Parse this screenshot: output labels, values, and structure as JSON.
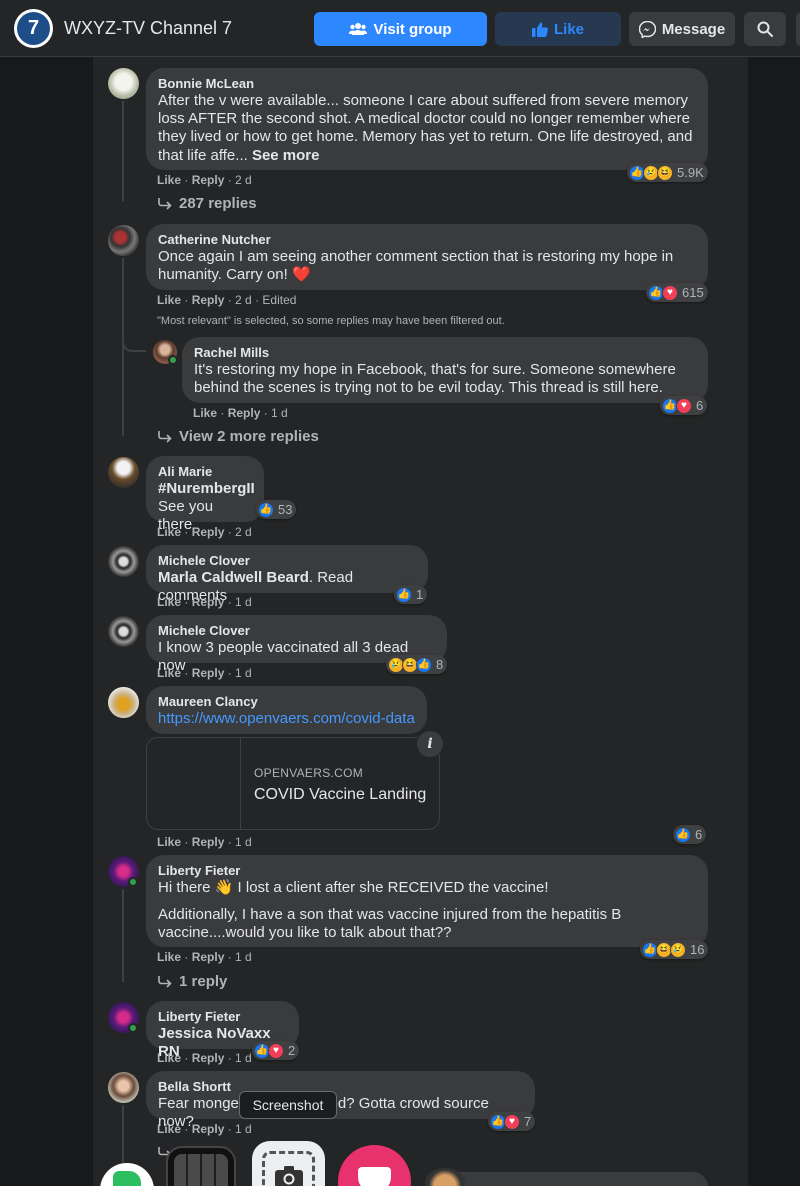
{
  "header": {
    "logo_text": "7",
    "page_name": "WXYZ-TV Channel 7",
    "visit_group_label": "Visit group",
    "like_label": "Like",
    "message_label": "Message"
  },
  "comments": [
    {
      "author": "Bonnie McLean",
      "text": "After the v were available... someone I care about suffered from severe memory loss AFTER the second shot. A medical doctor could no longer remember where they lived or how to get home. Memory has yet to return. One life destroyed, and that life affe...",
      "see_more": "See more",
      "like": "Like",
      "reply": "Reply",
      "time": "2 d",
      "reactions": [
        "like",
        "sad",
        "haha"
      ],
      "reaction_count": "5.9K",
      "replies_label": "287 replies"
    },
    {
      "author": "Catherine Nutcher",
      "text": "Once again I am seeing another comment section that is restoring my hope in humanity. Carry on! ❤️",
      "like": "Like",
      "reply": "Reply",
      "time": "2 d",
      "edited": "Edited",
      "reactions": [
        "like",
        "love"
      ],
      "reaction_count": "615",
      "filter_note": "\"Most relevant\" is selected, so some replies may have been filtered out.",
      "reply_item": {
        "author": "Rachel Mills",
        "text": "It's restoring my hope in Facebook, that's for sure. Someone somewhere behind the scenes is trying not to be evil today. This thread is still here.",
        "like": "Like",
        "reply": "Reply",
        "time": "1 d",
        "reactions": [
          "like",
          "love"
        ],
        "reaction_count": "6"
      },
      "replies_label": "View 2 more replies"
    },
    {
      "author": "Ali Marie",
      "text_line1": "#NurembergII",
      "text_line2": "See you there.",
      "like": "Like",
      "reply": "Reply",
      "time": "2 d",
      "reactions": [
        "like"
      ],
      "reaction_count": "53"
    },
    {
      "author": "Michele Clover",
      "mention": "Marla Caldwell Beard",
      "text": ". Read comments",
      "like": "Like",
      "reply": "Reply",
      "time": "1 d",
      "reactions": [
        "like"
      ],
      "reaction_count": "1"
    },
    {
      "author": "Michele Clover",
      "text": "I know 3 people vaccinated all 3 dead now",
      "like": "Like",
      "reply": "Reply",
      "time": "1 d",
      "reactions": [
        "sad",
        "haha",
        "like"
      ],
      "reaction_count": "8"
    },
    {
      "author": "Maureen Clancy",
      "link": "https://www.openvaers.com/covid-data",
      "preview_domain": "OPENVAERS.COM",
      "preview_title": "COVID Vaccine Landing",
      "like": "Like",
      "reply": "Reply",
      "time": "1 d",
      "reactions": [
        "like"
      ],
      "reaction_count": "6"
    },
    {
      "author": "Liberty Fieter",
      "text_line1": "Hi there 👋 I lost a client after she RECEIVED the vaccine!",
      "text_line2": "Additionally, I have a son that was vaccine injured from the hepatitis B vaccine....would you like to talk about that??",
      "like": "Like",
      "reply": "Reply",
      "time": "1 d",
      "reactions": [
        "like",
        "haha",
        "sad"
      ],
      "reaction_count": "16",
      "replies_label": "1 reply"
    },
    {
      "author": "Liberty Fieter",
      "mention": "Jessica NoVaxx RN",
      "like": "Like",
      "reply": "Reply",
      "time": "1 d",
      "reactions": [
        "like",
        "love"
      ],
      "reaction_count": "2"
    },
    {
      "author": "Bella Shortt",
      "text_start": "Fear monger",
      "text_end": "d? Gotta crowd source now?",
      "like": "Like",
      "reply": "Reply",
      "time": "1 d",
      "reactions": [
        "like",
        "love"
      ],
      "reaction_count": "7"
    }
  ],
  "overlay": {
    "tooltip": "Screenshot"
  },
  "colors": {
    "background": "#18191a",
    "surface": "#242526",
    "bubble": "#3a3b3c",
    "accent": "#2d88ff",
    "link": "#4599ff",
    "text": "#e4e6eb",
    "secondary_text": "#b0b3b8"
  },
  "icons": [
    "group-icon",
    "thumbs-up-icon",
    "messenger-icon",
    "search-icon",
    "reply-arrow-icon",
    "info-icon",
    "camera-icon"
  ]
}
